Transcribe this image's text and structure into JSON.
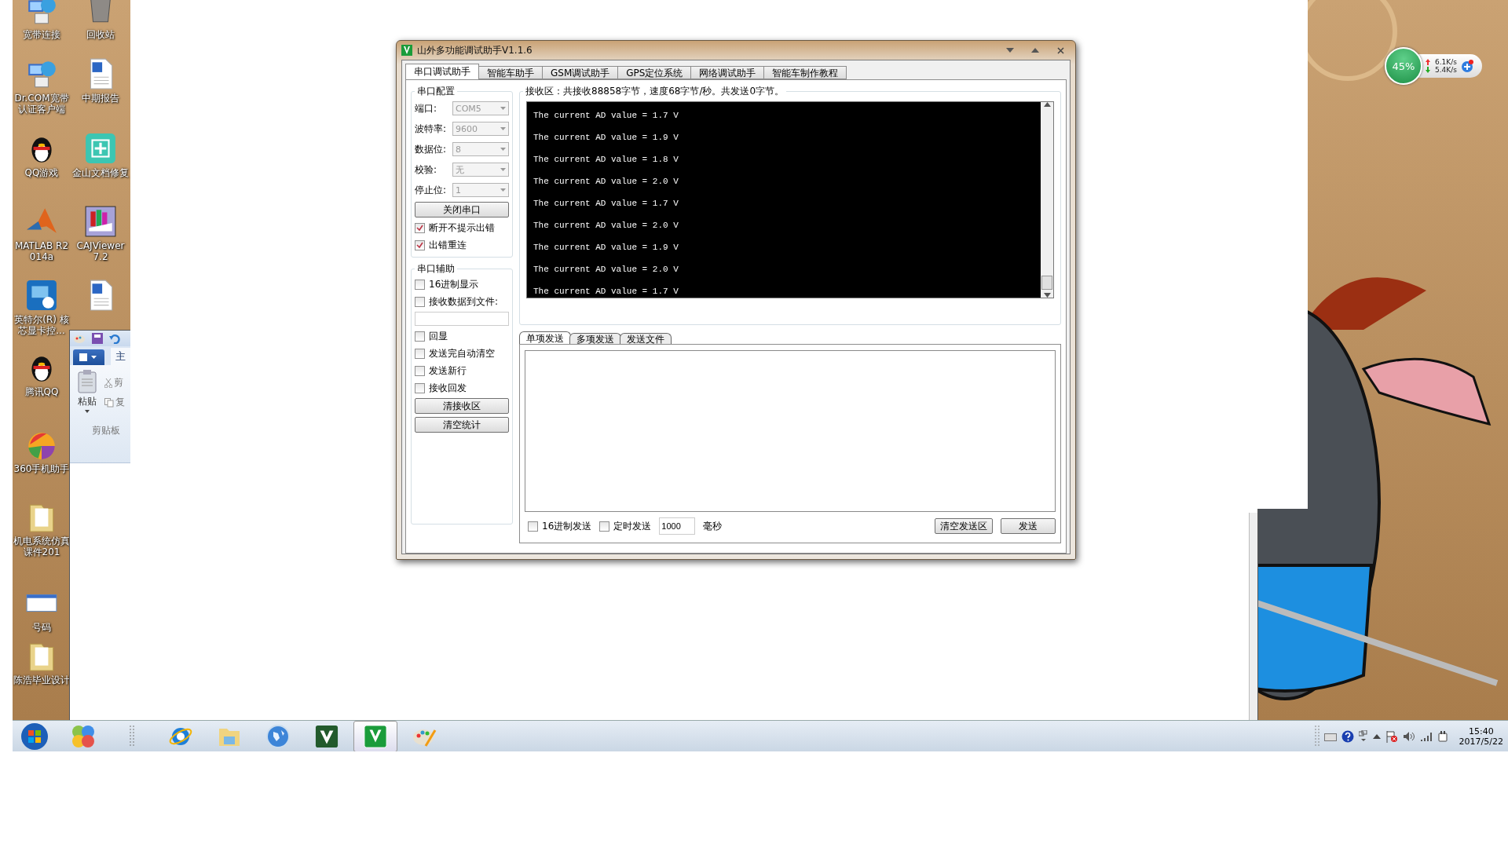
{
  "desktop_icons": [
    {
      "kind": "network",
      "label": "宽带连接"
    },
    {
      "kind": "recycle_bin",
      "label": "回收站"
    },
    {
      "kind": "network",
      "label": "Dr.COM宽带认证客户端"
    },
    {
      "kind": "document",
      "label": "中期报告"
    },
    {
      "kind": "penguin",
      "label": "QQ游戏"
    },
    {
      "kind": "repair",
      "label": "金山文档修复"
    },
    {
      "kind": "matlab",
      "label": "MATLAB R2014a"
    },
    {
      "kind": "books",
      "label": "CAJViewer 7.2"
    },
    {
      "kind": "chip",
      "label": "英特尔(R) 核芯显卡控..."
    },
    {
      "kind": "document"
    },
    {
      "kind": "penguin",
      "label": "腾讯QQ"
    },
    {
      "kind": "ball",
      "label": "360手机助手"
    },
    {
      "kind": "folder",
      "label": "机电系统仿真课件201"
    },
    {
      "kind": "screen",
      "label": "号码"
    },
    {
      "kind": "folder",
      "label": "陈浩毕业设计"
    }
  ],
  "paint_window": {
    "ribbon_tab": "主",
    "paste": "粘贴",
    "cut": "剪",
    "copy": "复",
    "group": "剪贴板"
  },
  "app": {
    "title": "山外多功能调试助手V1.1.6",
    "tabs": [
      {
        "label": "串口调试助手",
        "selected": true
      },
      {
        "label": "智能车助手",
        "selected": false
      },
      {
        "label": "GSM调试助手",
        "selected": false
      },
      {
        "label": "GPS定位系统",
        "selected": false
      },
      {
        "label": "网络调试助手",
        "selected": false
      },
      {
        "label": "智能车制作教程",
        "selected": false
      }
    ],
    "config": {
      "title": "串口配置",
      "fields": [
        {
          "label": "端口:",
          "value": "COM5",
          "disabled": true
        },
        {
          "label": "波特率:",
          "value": "9600",
          "disabled": true
        },
        {
          "label": "数据位:",
          "value": "8",
          "disabled": true
        },
        {
          "label": "校验:",
          "value": "无",
          "disabled": true
        },
        {
          "label": "停止位:",
          "value": "1",
          "disabled": true
        }
      ],
      "button": "关闭串口",
      "options": [
        {
          "label": "断开不提示出错",
          "checked": true
        },
        {
          "label": "出错重连",
          "checked": true
        }
      ]
    },
    "assist": {
      "title": "串口辅助",
      "options_top": [
        {
          "label": "16进制显示",
          "checked": false
        },
        {
          "label": "接收数据到文件:",
          "checked": false
        }
      ],
      "options": [
        {
          "label": "回显",
          "checked": false
        },
        {
          "label": "发送完自动清空",
          "checked": false
        },
        {
          "label": "发送新行",
          "checked": false
        },
        {
          "label": "接收回发",
          "checked": false
        }
      ],
      "buttons": [
        "清接收区",
        "清空统计"
      ]
    },
    "receive": {
      "heading": "接收区：共接收88858字节，速度68字节/秒。共发送0字节。",
      "lines": [
        "The current AD value = 1.7 V",
        "The current AD value = 1.9 V",
        "The current AD value = 1.8 V",
        "The current AD value = 2.0 V",
        "The current AD value = 1.7 V",
        "The current AD value = 2.0 V",
        "The current AD value = 1.9 V",
        "The current AD value = 2.0 V",
        "The current AD value = 1.7 V"
      ]
    },
    "send_tabs": [
      {
        "label": "单项发送",
        "selected": true
      },
      {
        "label": "多项发送",
        "selected": false
      },
      {
        "label": "发送文件",
        "selected": false
      }
    ],
    "send_options": [
      {
        "label": "16进制发送",
        "checked": false
      },
      {
        "label": "定时发送",
        "checked": false
      }
    ],
    "interval": "1000",
    "interval_unit": "毫秒",
    "send_buttons": [
      "清空发送区",
      "发送"
    ]
  },
  "network_meter": {
    "percent": "45%",
    "upload": "6.1K/s",
    "download": "5.4K/s"
  },
  "taskbar": {
    "items": [
      {
        "kind": "start",
        "selected": false
      },
      {
        "kind": "circles",
        "selected": false
      },
      {
        "kind": "grip",
        "selected": false
      },
      {
        "kind": "browser",
        "selected": false
      },
      {
        "kind": "folder",
        "selected": false
      },
      {
        "kind": "globe",
        "selected": false
      },
      {
        "kind": "mu",
        "selected": false
      },
      {
        "kind": "v",
        "selected": true
      },
      {
        "kind": "paint",
        "selected": false
      }
    ],
    "clock": {
      "time": "15:40",
      "date": "2017/5/22"
    }
  }
}
